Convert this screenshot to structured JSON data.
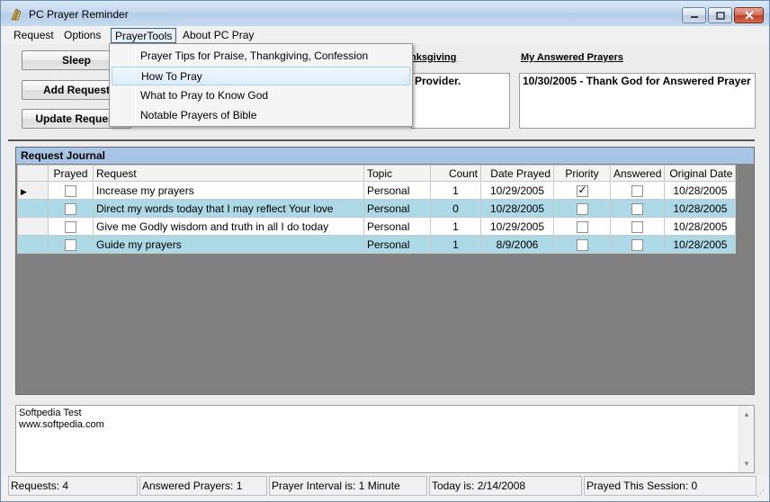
{
  "window": {
    "title": "PC Prayer Reminder",
    "minimize_glyph": "–",
    "maximize_glyph": "□",
    "close_glyph": "✕"
  },
  "menubar": {
    "items": [
      "Request",
      "Options",
      "PrayerTools",
      "About PC Pray"
    ]
  },
  "dropdown": {
    "items": [
      "Prayer Tips for Praise, Thankgiving, Confession",
      "How To Pray",
      "What to Pray to Know God",
      "Notable Prayers of Bible"
    ]
  },
  "top": {
    "sleep_label": "Sleep",
    "add_label": "Add Request",
    "update_label": "Update Request",
    "thanks_label_partial": "nksgiving",
    "thanks_text": "Provider.",
    "answered_label": "My Answered Prayers",
    "answered_text": "10/30/2005 - Thank God for Answered Prayer"
  },
  "grid": {
    "caption": "Request Journal",
    "columns": [
      "Prayed",
      "Request",
      "Topic",
      "Count",
      "Date Prayed",
      "Priority",
      "Answered",
      "Original Date"
    ],
    "rows": [
      {
        "prayed": false,
        "request": "Increase my prayers",
        "topic": "Personal",
        "count": "1",
        "date_prayed": "10/29/2005",
        "priority": true,
        "answered": false,
        "original_date": "10/28/2005"
      },
      {
        "prayed": false,
        "request": "Direct my words today that I may reflect Your love",
        "topic": "Personal",
        "count": "0",
        "date_prayed": "10/28/2005",
        "priority": false,
        "answered": false,
        "original_date": "10/28/2005"
      },
      {
        "prayed": false,
        "request": "Give me Godly wisdom and truth in all I do today",
        "topic": "Personal",
        "count": "1",
        "date_prayed": "10/29/2005",
        "priority": false,
        "answered": false,
        "original_date": "10/28/2005"
      },
      {
        "prayed": false,
        "request": "Guide my prayers",
        "topic": "Personal",
        "count": "1",
        "date_prayed": "8/9/2006",
        "priority": false,
        "answered": false,
        "original_date": "10/28/2005"
      }
    ]
  },
  "notes": {
    "line1": "Softpedia Test",
    "line2": "www.softpedia.com"
  },
  "status": {
    "requests": "Requests: 4",
    "answered": "Answered Prayers: 1",
    "interval": "Prayer Interval is: 1 Minute",
    "today": "Today is: 2/14/2008",
    "session": "Prayed This Session: 0"
  }
}
